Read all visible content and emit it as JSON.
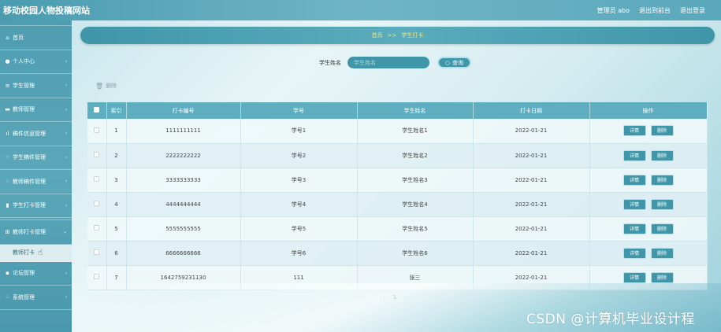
{
  "header": {
    "title": "移动校园人物投稿网站",
    "admin_label": "管理员 abo",
    "back_to_front": "退出到前台",
    "logout": "退出登录"
  },
  "sidebar": {
    "items": [
      {
        "label": "首页",
        "icon": "home-icon",
        "glyph": "⌂"
      },
      {
        "label": "个人中心",
        "icon": "user-icon",
        "glyph": "●"
      },
      {
        "label": "学生管理",
        "icon": "list-icon",
        "glyph": "≡"
      },
      {
        "label": "教师管理",
        "icon": "monitor-icon",
        "glyph": "▬"
      },
      {
        "label": "稿件信息管理",
        "icon": "chart-icon",
        "glyph": "ıl"
      },
      {
        "label": "学生稿件管理",
        "icon": "grid-icon",
        "glyph": "⁘"
      },
      {
        "label": "教师稿件管理",
        "icon": "grid-icon",
        "glyph": "⁘"
      },
      {
        "label": "学生打卡管理",
        "icon": "bar-icon",
        "glyph": "▮"
      },
      {
        "label": "教师打卡管理",
        "icon": "grid-icon",
        "glyph": "⊞"
      },
      {
        "label": "论坛管理",
        "icon": "trash-icon",
        "glyph": "▪"
      },
      {
        "label": "系统管理",
        "icon": "grid-icon",
        "glyph": "⁘"
      }
    ],
    "submenu_label": "教师打卡"
  },
  "breadcrumb": {
    "home": "首页",
    "separator": ">>",
    "current": "学生打卡"
  },
  "search": {
    "label": "学生姓名",
    "placeholder": "学生姓名",
    "button": "查询"
  },
  "batch_delete": "删除",
  "table": {
    "columns": [
      "索引",
      "打卡编号",
      "学号",
      "学生姓名",
      "打卡日期",
      "操作"
    ],
    "rows": [
      {
        "index": "1",
        "code": "1111111111",
        "student_no": "学号1",
        "name": "学生姓名1",
        "date": "2022-01-21"
      },
      {
        "index": "2",
        "code": "2222222222",
        "student_no": "学号2",
        "name": "学生姓名2",
        "date": "2022-01-21"
      },
      {
        "index": "3",
        "code": "3333333333",
        "student_no": "学号3",
        "name": "学生姓名3",
        "date": "2022-01-21"
      },
      {
        "index": "4",
        "code": "4444444444",
        "student_no": "学号4",
        "name": "学生姓名4",
        "date": "2022-01-21"
      },
      {
        "index": "5",
        "code": "5555555555",
        "student_no": "学号5",
        "name": "学生姓名5",
        "date": "2022-01-21"
      },
      {
        "index": "6",
        "code": "6666666666",
        "student_no": "学号6",
        "name": "学生姓名6",
        "date": "2022-01-21"
      },
      {
        "index": "7",
        "code": "1642759231130",
        "student_no": "111",
        "name": "张三",
        "date": "2022-01-21"
      }
    ],
    "detail_button": "详情",
    "delete_button": "删除"
  },
  "pager": {
    "prev": "‹",
    "current": "1",
    "next": "›"
  },
  "watermark": "CSDN @计算机毕业设计程"
}
